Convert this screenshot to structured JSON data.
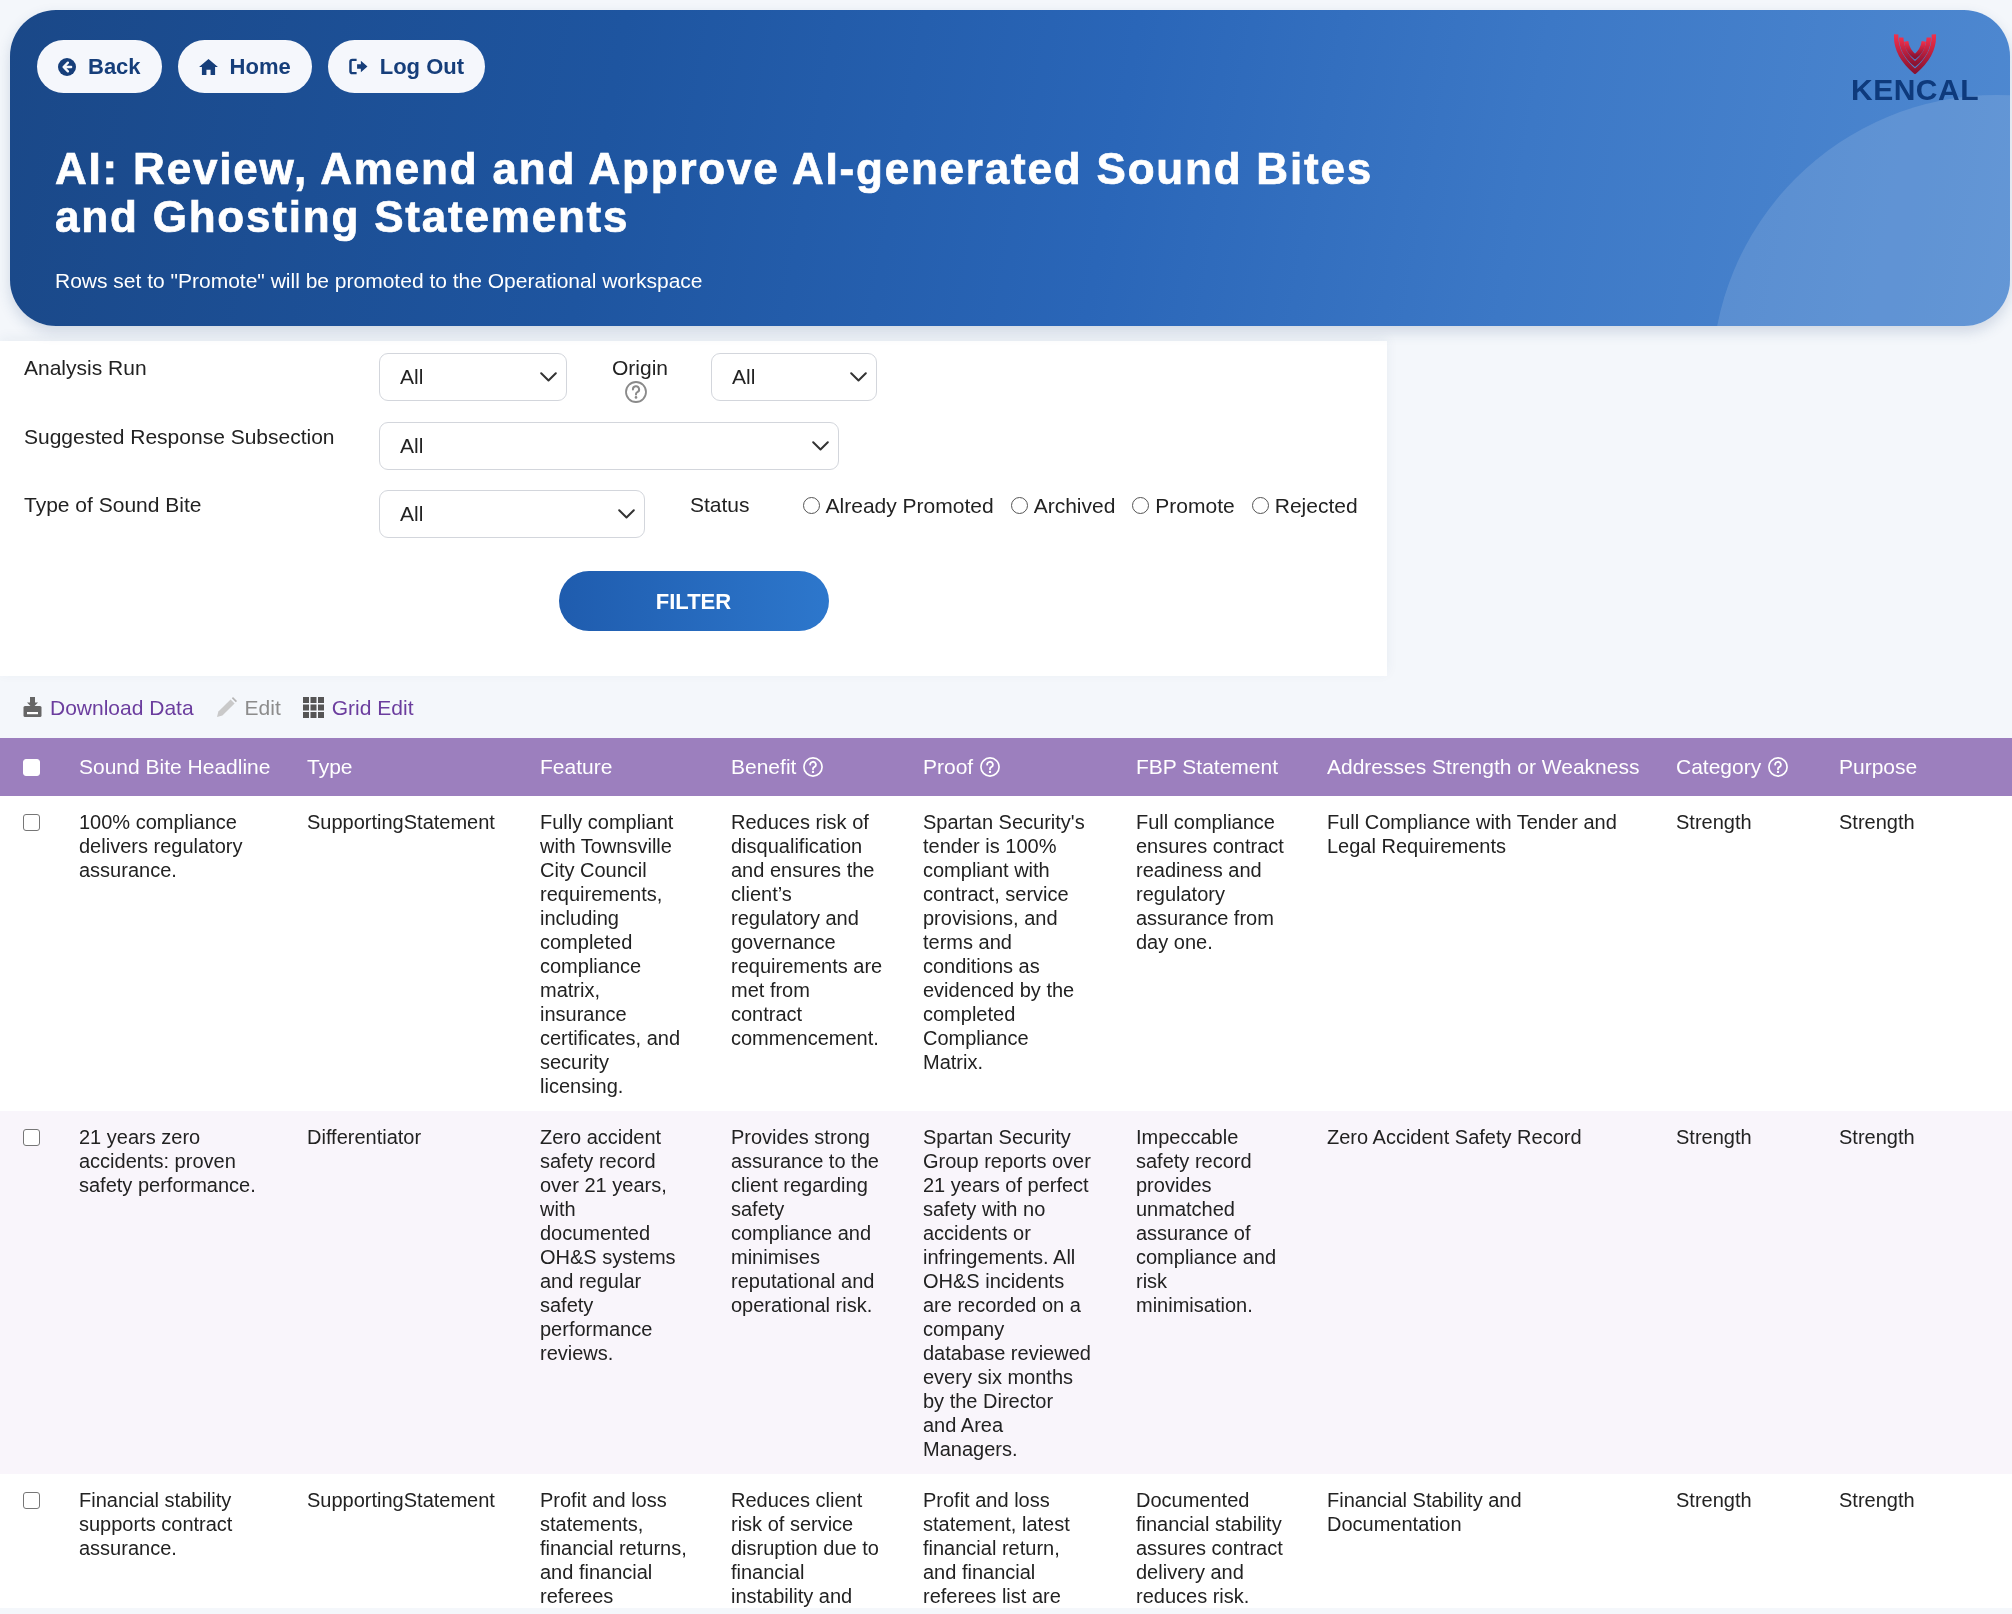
{
  "header": {
    "buttons": [
      {
        "kind": "back",
        "label": "Back"
      },
      {
        "kind": "home",
        "label": "Home"
      },
      {
        "kind": "logout",
        "label": "Log Out"
      }
    ],
    "logo": "KENCAL",
    "title": "AI: Review, Amend and Approve AI-generated Sound Bites and Ghosting Statements",
    "subtitle": "Rows set to \"Promote\" will be promoted to the Operational workspace"
  },
  "filters": {
    "analysis_run": {
      "label": "Analysis Run",
      "value": "All"
    },
    "origin": {
      "label": "Origin",
      "help": true,
      "value": "All"
    },
    "suggested_response_subsection": {
      "label": "Suggested Response Subsection",
      "value": "All"
    },
    "type_of_sound_bite": {
      "label": "Type of Sound Bite",
      "value": "All"
    },
    "status": {
      "label": "Status",
      "options": [
        {
          "label": "Already Promoted",
          "selected": false
        },
        {
          "label": "Archived",
          "selected": false
        },
        {
          "label": "Promote",
          "selected": false
        },
        {
          "label": "Rejected",
          "selected": false
        }
      ]
    },
    "filter_button": "FILTER"
  },
  "toolbar": [
    {
      "kind": "download",
      "label": "Download Data",
      "disabled": false
    },
    {
      "kind": "edit",
      "label": "Edit",
      "disabled": true
    },
    {
      "kind": "grid",
      "label": "Grid Edit",
      "disabled": false
    }
  ],
  "table": {
    "select_all": {
      "checked": false
    },
    "columns": [
      {
        "label": "Sound Bite Headline",
        "help": false
      },
      {
        "label": "Type",
        "help": false
      },
      {
        "label": "Feature",
        "help": false
      },
      {
        "label": "Benefit",
        "help": true
      },
      {
        "label": "Proof",
        "help": true
      },
      {
        "label": "FBP Statement",
        "help": false
      },
      {
        "label": "Addresses Strength or Weakness",
        "help": false
      },
      {
        "label": "Category",
        "help": true
      },
      {
        "label": "Purpose",
        "help": false
      }
    ],
    "rows": [
      {
        "checked": false,
        "cells": [
          "100% compliance delivers regulatory assurance.",
          "SupportingStatement",
          "Fully compliant with Townsville City Council requirements, including completed compliance matrix, insurance certificates, and security licensing.",
          "Reduces risk of disqualification and ensures the client’s regulatory and governance requirements are met from contract commencement.",
          "Spartan Security's tender is 100% compliant with contract, service provisions, and terms and conditions as evidenced by the completed Compliance Matrix.",
          "Full compliance ensures contract readiness and regulatory assurance from day one.",
          "Full Compliance with Tender and Legal Requirements",
          "Strength",
          "Strength"
        ]
      },
      {
        "checked": false,
        "cells": [
          "21 years zero accidents: proven safety performance.",
          "Differentiator",
          "Zero accident safety record over 21 years, with documented OH&S systems and regular safety performance reviews.",
          "Provides strong assurance to the client regarding safety compliance and minimises reputational and operational risk.",
          "Spartan Security Group reports over 21 years of perfect safety with no accidents or infringements. All OH&S incidents are recorded on a company database reviewed every six months by the Director and Area Managers.",
          "Impeccable safety record provides unmatched assurance of compliance and risk minimisation.",
          "Zero Accident Safety Record",
          "Strength",
          "Strength"
        ]
      },
      {
        "checked": false,
        "cells": [
          "Financial stability supports contract assurance.",
          "SupportingStatement",
          "Profit and loss statements, financial returns, and financial referees",
          "Reduces client risk of service disruption due to financial instability and",
          "Profit and loss statement, latest financial return, and financial referees list are",
          "Documented financial stability assures contract delivery and reduces risk.",
          "Financial Stability and Documentation",
          "Strength",
          "Strength"
        ]
      }
    ]
  }
}
